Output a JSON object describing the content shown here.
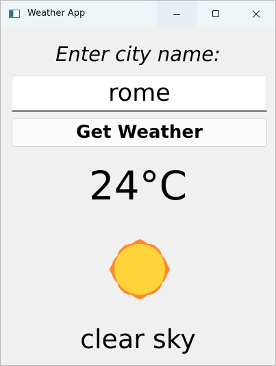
{
  "window": {
    "title": "Weather App",
    "controls": {
      "minimize": "minimize",
      "maximize": "maximize",
      "close": "close"
    }
  },
  "form": {
    "prompt": "Enter city name:",
    "city_value": "rome",
    "button_label": "Get Weather"
  },
  "weather": {
    "temperature": "24°C",
    "condition": "clear sky",
    "icon": "sun-icon"
  },
  "colors": {
    "sun_outer": "#ff8a2a",
    "sun_inner": "#ffd43b",
    "titlebar": "#eef5f8"
  }
}
